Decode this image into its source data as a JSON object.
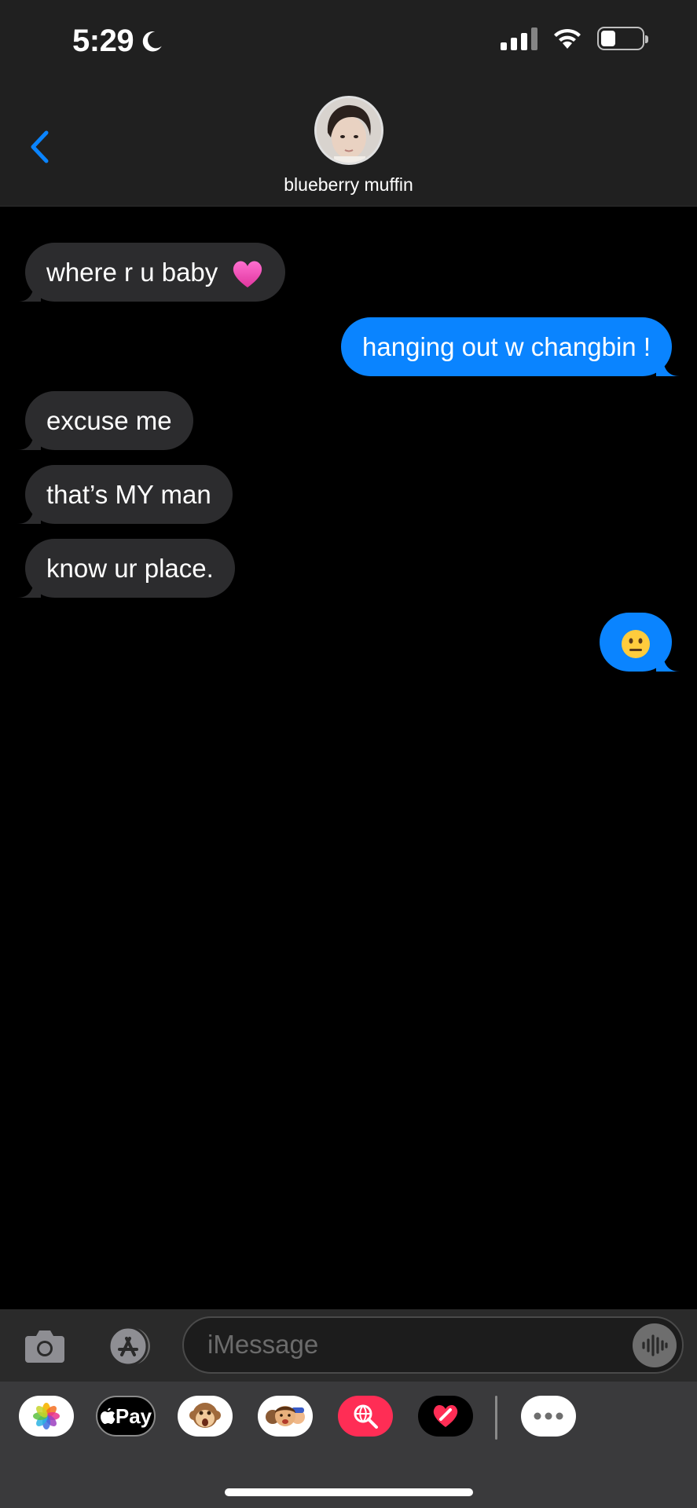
{
  "status_bar": {
    "time": "5:29"
  },
  "header": {
    "contact_name": "blueberry muffin"
  },
  "messages": [
    {
      "direction": "in",
      "text": "where r u baby",
      "emoji": "pink-heart"
    },
    {
      "direction": "out",
      "text": "hanging out w changbin !"
    },
    {
      "direction": "in",
      "text": "excuse me"
    },
    {
      "direction": "in",
      "text": "that’s MY man"
    },
    {
      "direction": "in",
      "text": "know ur place."
    },
    {
      "direction": "out",
      "text": "",
      "emoji": "neutral-face"
    }
  ],
  "input": {
    "placeholder": "iMessage",
    "value": ""
  },
  "app_drawer": {
    "apps": [
      "photos",
      "apple-pay",
      "animoji",
      "memoji",
      "search-images",
      "digital-touch",
      "more"
    ],
    "apple_pay_label": "Pay"
  },
  "colors": {
    "accent": "#0a84ff",
    "incoming_bubble": "#2c2c2e",
    "header_bg": "#202020"
  }
}
